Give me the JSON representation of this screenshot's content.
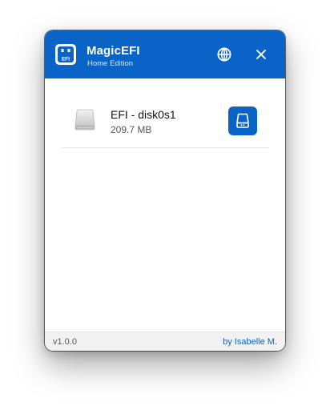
{
  "app": {
    "title": "MagicEFI",
    "subtitle": "Home Edition",
    "logo_text": "EFI",
    "accent_color": "#0a64c8"
  },
  "header": {
    "language_icon": "globe-icon",
    "close_icon": "close-icon"
  },
  "disks": [
    {
      "name": "EFI - disk0s1",
      "size": "209.7 MB",
      "icon": "hard-drive-icon",
      "action_icon": "mount-drive-icon"
    }
  ],
  "footer": {
    "version": "v1.0.0",
    "author": "by Isabelle M."
  }
}
